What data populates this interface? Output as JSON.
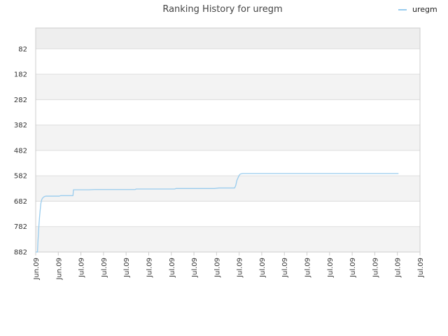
{
  "chart_data": {
    "type": "line",
    "title": "Ranking History for uregm",
    "xlabel": "",
    "ylabel": "",
    "x_tick_labels": [
      "Jun.09",
      "Jun.09",
      "Jul.09",
      "Jul.09",
      "Jul.09",
      "Jul.09",
      "Jul.09",
      "Jul.09",
      "Jul.09",
      "Jul.09",
      "Jul.09",
      "Jul.09",
      "Jul.09",
      "Jul.09",
      "Jul.09",
      "Jul.09",
      "Jul.09",
      "Jul.09"
    ],
    "y_tick_labels": [
      "82",
      "182",
      "282",
      "382",
      "482",
      "582",
      "682",
      "782",
      "882"
    ],
    "y_ticks": [
      82,
      182,
      282,
      382,
      482,
      582,
      682,
      782,
      882
    ],
    "ylim": [
      882,
      0
    ],
    "y_inverted": true,
    "xlim": [
      0,
      17
    ],
    "grid": true,
    "legend_position": "top-right",
    "series": [
      {
        "name": "uregm",
        "color": "#99ccee",
        "x": [
          0.0,
          0.08,
          0.1,
          0.14,
          0.17,
          0.2,
          0.23,
          0.27,
          0.32,
          0.38,
          0.45,
          0.55,
          1.05,
          1.1,
          1.65,
          1.67,
          2.35,
          2.6,
          4.4,
          4.45,
          6.15,
          6.2,
          7.9,
          8.1,
          8.8,
          8.85,
          8.9,
          8.95,
          9.0,
          9.05,
          9.15,
          10.5,
          14.6,
          14.8,
          16.05
        ],
        "y": [
          882,
          882,
          840,
          780,
          745,
          715,
          690,
          675,
          668,
          664,
          662,
          662,
          662,
          660,
          660,
          637,
          637,
          636,
          636,
          634,
          634,
          632,
          632,
          630,
          630,
          620,
          600,
          590,
          580,
          575,
          573,
          573,
          573,
          573,
          573
        ]
      }
    ],
    "colors": {
      "band_alt": "#f3f3f3",
      "band_top": "#eeeeee",
      "grid": "#dddddd",
      "axis": "#cccccc"
    }
  }
}
